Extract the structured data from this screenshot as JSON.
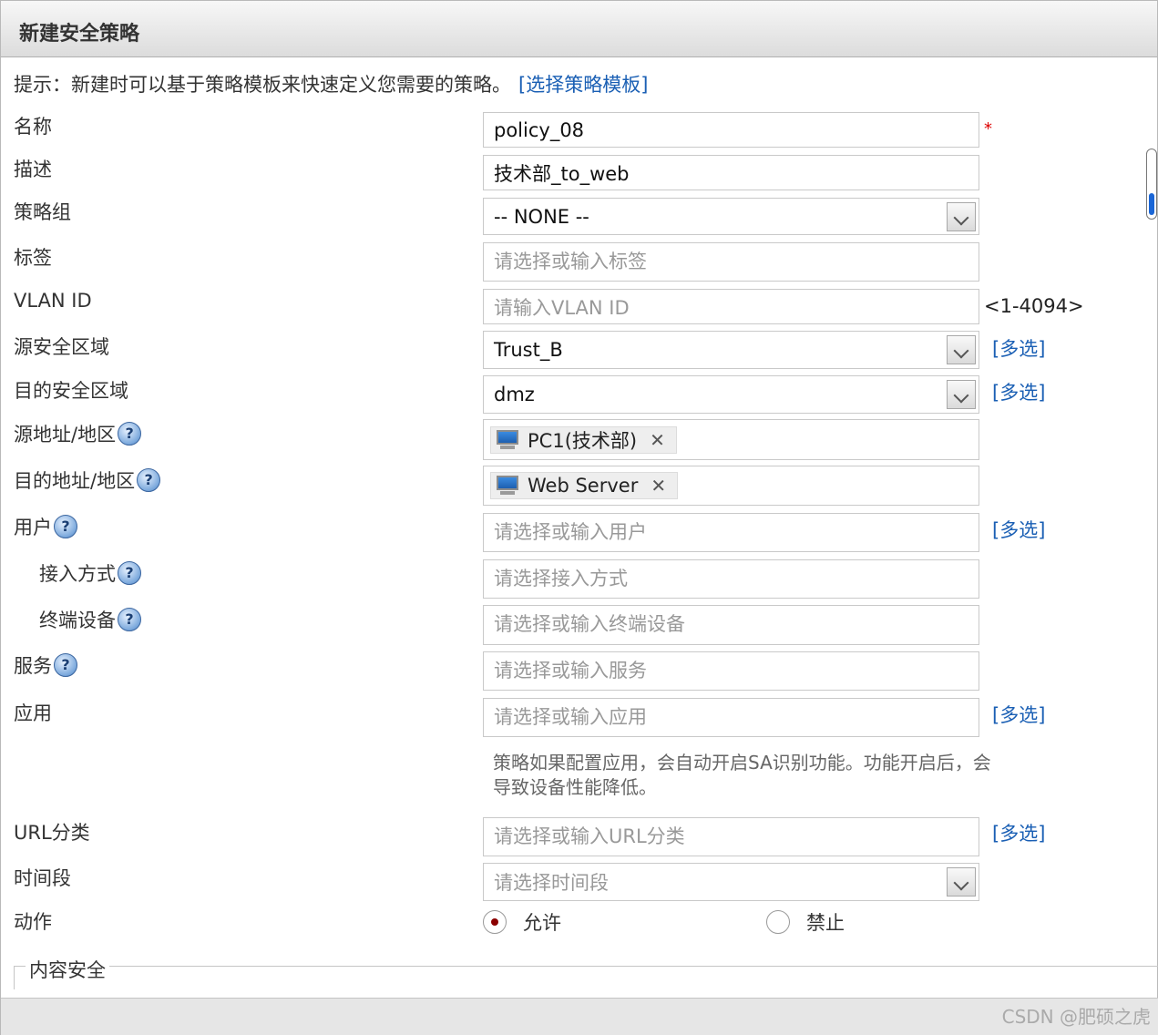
{
  "dialog": {
    "title": "新建安全策略"
  },
  "hint": {
    "text": "提示：新建时可以基于策略模板来快速定义您需要的策略。",
    "link": "[选择策略模板]"
  },
  "labels": {
    "name": "名称",
    "desc": "描述",
    "policy_group": "策略组",
    "tag": "标签",
    "vlan": "VLAN ID",
    "src_zone": "源安全区域",
    "dst_zone": "目的安全区域",
    "src_addr": "源地址/地区",
    "dst_addr": "目的地址/地区",
    "user": "用户",
    "access": "接入方式",
    "terminal": "终端设备",
    "service": "服务",
    "app": "应用",
    "url": "URL分类",
    "time": "时间段",
    "action": "动作"
  },
  "fields": {
    "name_value": "policy_08",
    "desc_value": "技术部_to_web",
    "policy_group_value": "-- NONE --",
    "tag_placeholder": "请选择或输入标签",
    "vlan_placeholder": "请输入VLAN ID",
    "vlan_range": "<1-4094>",
    "src_zone_value": "Trust_B",
    "dst_zone_value": "dmz",
    "src_addr_tag": "PC1(技术部)",
    "dst_addr_tag": "Web Server",
    "user_placeholder": "请选择或输入用户",
    "access_placeholder": "请选择接入方式",
    "terminal_placeholder": "请选择或输入终端设备",
    "service_placeholder": "请选择或输入服务",
    "app_placeholder": "请选择或输入应用",
    "app_note": "策略如果配置应用，会自动开启SA识别功能。功能开启后，会导致设备性能降低。",
    "url_placeholder": "请选择或输入URL分类",
    "time_placeholder": "请选择时间段"
  },
  "required_mark": "*",
  "multi_select": "[多选]",
  "help_glyph": "?",
  "remove_glyph": "✕",
  "action": {
    "permit": "允许",
    "deny": "禁止",
    "selected": "permit"
  },
  "content_security": {
    "legend": "内容安全"
  },
  "watermark": "CSDN @肥硕之虎",
  "colors": {
    "link": "#1a5fb4",
    "required": "#dd0000",
    "radio_selected": "#8b0000"
  }
}
